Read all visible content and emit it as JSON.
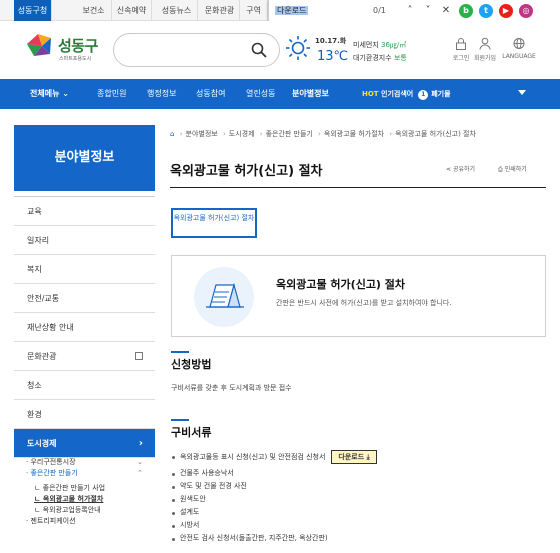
{
  "topbar": {
    "tabs": [
      "성동구청",
      "보건소",
      "신속예약",
      "성동뉴스",
      "문화관광",
      "구역"
    ]
  },
  "findbar": {
    "query": "다운로드",
    "count": "0/1",
    "up": "˄",
    "down": "˅",
    "close": "✕"
  },
  "social": [
    "b",
    "t",
    "▶",
    "◎"
  ],
  "logo": {
    "name": "성동구",
    "tagline": "스마트포용도시"
  },
  "weather": {
    "date": "10.17.화",
    "temp": "13℃",
    "dust_label": "미세먼지",
    "dust_value": "36㎍/㎥",
    "air_label": "대기환경지수",
    "air_value": "보통"
  },
  "utils": [
    "로그인",
    "회원가입",
    "LANGUAGE"
  ],
  "gnb": {
    "all": "전체메뉴",
    "items": [
      "종합민원",
      "행정정보",
      "성동참여",
      "열린성동",
      "분야별정보"
    ],
    "hot_label": "HOT",
    "hot_text": "인기검색어",
    "hot_rank": "1",
    "hot_word": "폐기물"
  },
  "sidebar": {
    "title": "분야별정보",
    "items": [
      "교육",
      "일자리",
      "복지",
      "안전/교통",
      "재난상황 안내",
      "문화관광",
      "청소",
      "환경",
      "도시경제"
    ],
    "sub": [
      "· 우리구전통시장",
      "· 좋은간판 만들기",
      "ㄴ 좋은간판 만들기 사업",
      "ㄴ 옥외광고물 허가절차",
      "ㄴ 옥외광고업등록안내",
      "· 젠트리피케이션"
    ]
  },
  "breadcrumb": [
    "분야별정보",
    "도시경제",
    "좋은간판 만들기",
    "옥외광고물 허가절차",
    "옥외광고물 허가(신고) 절차"
  ],
  "page": {
    "title": "옥외광고물 허가(신고) 절차",
    "share": "공유하기",
    "print": "인쇄하기",
    "tab": "옥외광고물 허가(신고) 절차",
    "info_title": "옥외광고물 허가(신고) 절차",
    "info_desc": "간판은 반드시 사전에 허가(신고)를 받고 설치하여야 합니다.",
    "sec1_title": "신청방법",
    "sec1_text": "구비서류를 갖춘 후 도시계획과 방문 접수",
    "sec2_title": "구비서류",
    "docs": [
      "옥외광고물등 표시 신청(신고) 및 안전점검 신청서",
      "건물주 사용승낙서",
      "약도 및 건물 전경 사진",
      "원색도안",
      "설계도",
      "시방서",
      "안전도 검사 신청서(돌출간판, 지주간판, 옥상간판)"
    ],
    "download": "다운로드"
  },
  "colors": {
    "primary": "#1466c8",
    "highlight": "#fff6c4"
  }
}
